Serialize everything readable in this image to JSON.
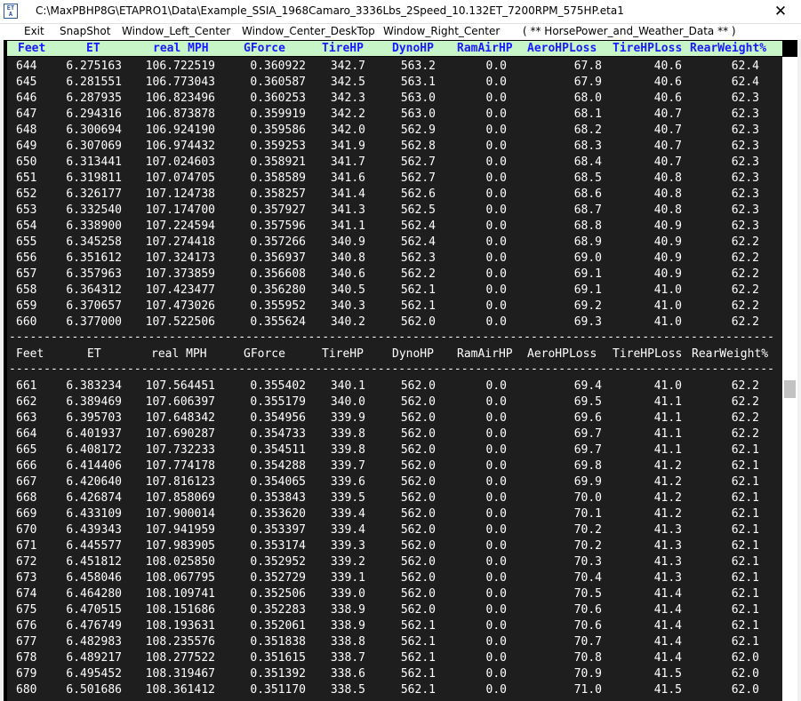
{
  "window": {
    "icon_text": "ET A",
    "title": "C:\\MaxPBHP8G\\ETAPRO1\\Data\\Example_SSIA_1968Camaro_3336Lbs_2Speed_10.132ET_7200RPM_575HP.eta1",
    "close_glyph": "✕"
  },
  "menu": [
    "Exit",
    "SnapShot",
    "Window_Left_Center",
    "Window_Center_DeskTop",
    "Window_Right_Center",
    "( ** HorsePower_and_Weather_Data ** )"
  ],
  "columns": [
    "Feet",
    "ET",
    "real MPH",
    "GForce",
    "TireHP",
    "DynoHP",
    "RamAirHP",
    "AeroHPLoss",
    "TireHPLoss",
    "RearWeight%"
  ],
  "divider": "----------------------------------------------------------------------------------------------------------------------------------",
  "rows_top": [
    [
      "644",
      "6.275163",
      "106.722519",
      "0.360922",
      "342.7",
      "563.2",
      "0.0",
      "67.8",
      "40.6",
      "62.4"
    ],
    [
      "645",
      "6.281551",
      "106.773043",
      "0.360587",
      "342.5",
      "563.1",
      "0.0",
      "67.9",
      "40.6",
      "62.4"
    ],
    [
      "646",
      "6.287935",
      "106.823496",
      "0.360253",
      "342.3",
      "563.0",
      "0.0",
      "68.0",
      "40.6",
      "62.3"
    ],
    [
      "647",
      "6.294316",
      "106.873878",
      "0.359919",
      "342.2",
      "563.0",
      "0.0",
      "68.1",
      "40.7",
      "62.3"
    ],
    [
      "648",
      "6.300694",
      "106.924190",
      "0.359586",
      "342.0",
      "562.9",
      "0.0",
      "68.2",
      "40.7",
      "62.3"
    ],
    [
      "649",
      "6.307069",
      "106.974432",
      "0.359253",
      "341.9",
      "562.8",
      "0.0",
      "68.3",
      "40.7",
      "62.3"
    ],
    [
      "650",
      "6.313441",
      "107.024603",
      "0.358921",
      "341.7",
      "562.7",
      "0.0",
      "68.4",
      "40.7",
      "62.3"
    ],
    [
      "651",
      "6.319811",
      "107.074705",
      "0.358589",
      "341.6",
      "562.7",
      "0.0",
      "68.5",
      "40.8",
      "62.3"
    ],
    [
      "652",
      "6.326177",
      "107.124738",
      "0.358257",
      "341.4",
      "562.6",
      "0.0",
      "68.6",
      "40.8",
      "62.3"
    ],
    [
      "653",
      "6.332540",
      "107.174700",
      "0.357927",
      "341.3",
      "562.5",
      "0.0",
      "68.7",
      "40.8",
      "62.3"
    ],
    [
      "654",
      "6.338900",
      "107.224594",
      "0.357596",
      "341.1",
      "562.4",
      "0.0",
      "68.8",
      "40.9",
      "62.3"
    ],
    [
      "655",
      "6.345258",
      "107.274418",
      "0.357266",
      "340.9",
      "562.4",
      "0.0",
      "68.9",
      "40.9",
      "62.2"
    ],
    [
      "656",
      "6.351612",
      "107.324173",
      "0.356937",
      "340.8",
      "562.3",
      "0.0",
      "69.0",
      "40.9",
      "62.2"
    ],
    [
      "657",
      "6.357963",
      "107.373859",
      "0.356608",
      "340.6",
      "562.2",
      "0.0",
      "69.1",
      "40.9",
      "62.2"
    ],
    [
      "658",
      "6.364312",
      "107.423477",
      "0.356280",
      "340.5",
      "562.1",
      "0.0",
      "69.1",
      "41.0",
      "62.2"
    ],
    [
      "659",
      "6.370657",
      "107.473026",
      "0.355952",
      "340.3",
      "562.1",
      "0.0",
      "69.2",
      "41.0",
      "62.2"
    ],
    [
      "660",
      "6.377000",
      "107.522506",
      "0.355624",
      "340.2",
      "562.0",
      "0.0",
      "69.3",
      "41.0",
      "62.2"
    ]
  ],
  "rows_bottom": [
    [
      "661",
      "6.383234",
      "107.564451",
      "0.355402",
      "340.1",
      "562.0",
      "0.0",
      "69.4",
      "41.0",
      "62.2"
    ],
    [
      "662",
      "6.389469",
      "107.606397",
      "0.355179",
      "340.0",
      "562.0",
      "0.0",
      "69.5",
      "41.1",
      "62.2"
    ],
    [
      "663",
      "6.395703",
      "107.648342",
      "0.354956",
      "339.9",
      "562.0",
      "0.0",
      "69.6",
      "41.1",
      "62.2"
    ],
    [
      "664",
      "6.401937",
      "107.690287",
      "0.354733",
      "339.8",
      "562.0",
      "0.0",
      "69.7",
      "41.1",
      "62.2"
    ],
    [
      "665",
      "6.408172",
      "107.732233",
      "0.354511",
      "339.8",
      "562.0",
      "0.0",
      "69.7",
      "41.1",
      "62.1"
    ],
    [
      "666",
      "6.414406",
      "107.774178",
      "0.354288",
      "339.7",
      "562.0",
      "0.0",
      "69.8",
      "41.2",
      "62.1"
    ],
    [
      "667",
      "6.420640",
      "107.816123",
      "0.354065",
      "339.6",
      "562.0",
      "0.0",
      "69.9",
      "41.2",
      "62.1"
    ],
    [
      "668",
      "6.426874",
      "107.858069",
      "0.353843",
      "339.5",
      "562.0",
      "0.0",
      "70.0",
      "41.2",
      "62.1"
    ],
    [
      "669",
      "6.433109",
      "107.900014",
      "0.353620",
      "339.4",
      "562.0",
      "0.0",
      "70.1",
      "41.2",
      "62.1"
    ],
    [
      "670",
      "6.439343",
      "107.941959",
      "0.353397",
      "339.4",
      "562.0",
      "0.0",
      "70.2",
      "41.3",
      "62.1"
    ],
    [
      "671",
      "6.445577",
      "107.983905",
      "0.353174",
      "339.3",
      "562.0",
      "0.0",
      "70.2",
      "41.3",
      "62.1"
    ],
    [
      "672",
      "6.451812",
      "108.025850",
      "0.352952",
      "339.2",
      "562.0",
      "0.0",
      "70.3",
      "41.3",
      "62.1"
    ],
    [
      "673",
      "6.458046",
      "108.067795",
      "0.352729",
      "339.1",
      "562.0",
      "0.0",
      "70.4",
      "41.3",
      "62.1"
    ],
    [
      "674",
      "6.464280",
      "108.109741",
      "0.352506",
      "339.0",
      "562.0",
      "0.0",
      "70.5",
      "41.4",
      "62.1"
    ],
    [
      "675",
      "6.470515",
      "108.151686",
      "0.352283",
      "338.9",
      "562.0",
      "0.0",
      "70.6",
      "41.4",
      "62.1"
    ],
    [
      "676",
      "6.476749",
      "108.193631",
      "0.352061",
      "338.9",
      "562.1",
      "0.0",
      "70.6",
      "41.4",
      "62.1"
    ],
    [
      "677",
      "6.482983",
      "108.235576",
      "0.351838",
      "338.8",
      "562.1",
      "0.0",
      "70.7",
      "41.4",
      "62.1"
    ],
    [
      "678",
      "6.489217",
      "108.277522",
      "0.351615",
      "338.7",
      "562.1",
      "0.0",
      "70.8",
      "41.4",
      "62.0"
    ],
    [
      "679",
      "6.495452",
      "108.319467",
      "0.351392",
      "338.6",
      "562.1",
      "0.0",
      "70.9",
      "41.5",
      "62.0"
    ],
    [
      "680",
      "6.501686",
      "108.361412",
      "0.351170",
      "338.5",
      "562.1",
      "0.0",
      "71.0",
      "41.5",
      "62.0"
    ]
  ]
}
